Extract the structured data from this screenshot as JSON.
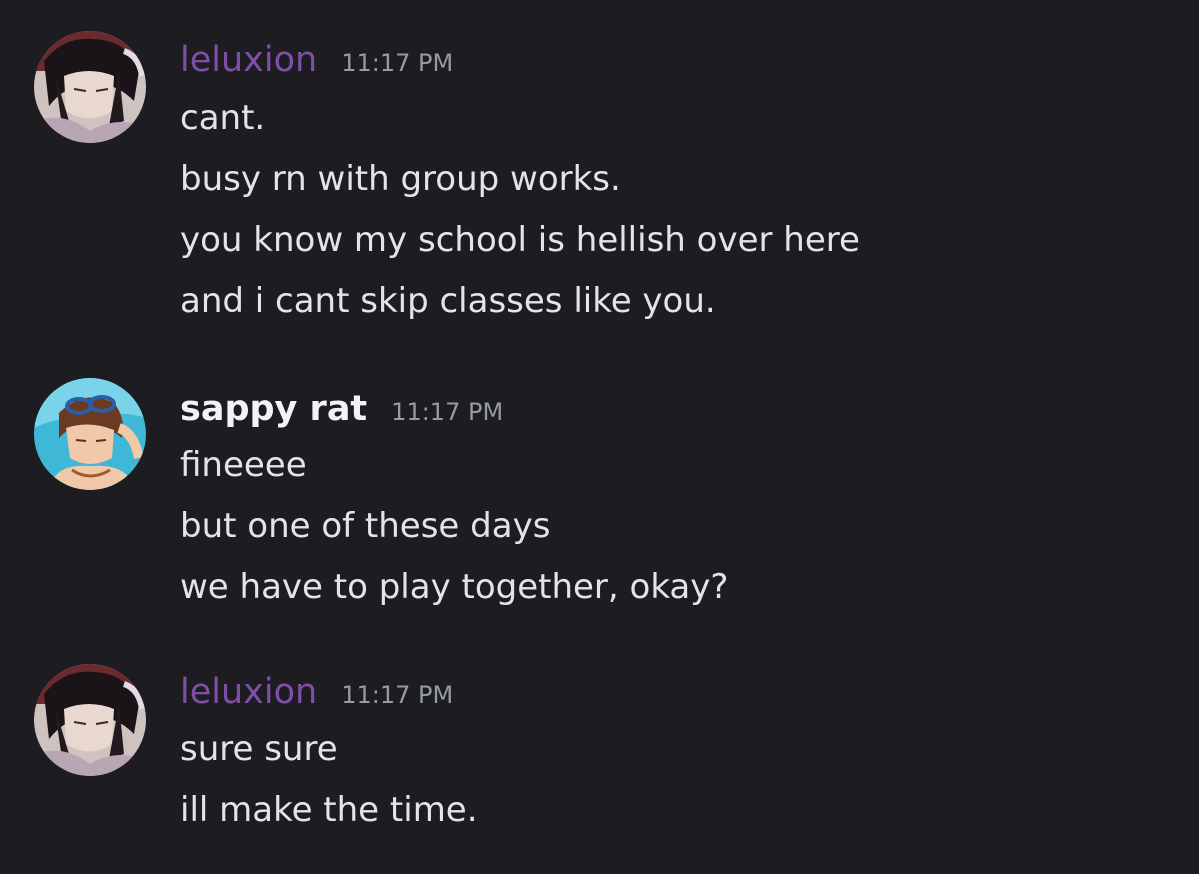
{
  "colors": {
    "background": "#1c1c21",
    "username_leluxion": "#7f4fa6",
    "username_sappy_rat": "#f2f3f5",
    "message_text": "#e3e4e8",
    "timestamp": "#949ba4"
  },
  "messages": [
    {
      "username": "leluxion",
      "timestamp": "11:17 PM",
      "avatar_icon": "dark-haired-anime-character-avatar",
      "lines": [
        "cant.",
        "busy rn with group works.",
        "you know my school is hellish over here",
        "and i cant skip classes like you."
      ]
    },
    {
      "username": "sappy rat",
      "timestamp": "11:17 PM",
      "avatar_icon": "brown-haired-swimmer-anime-avatar",
      "lines": [
        "fineeee",
        "but one of these days",
        "we have to play together, okay?"
      ]
    },
    {
      "username": "leluxion",
      "timestamp": "11:17 PM",
      "avatar_icon": "dark-haired-anime-character-avatar",
      "lines": [
        "sure sure",
        "ill make the time."
      ]
    }
  ]
}
